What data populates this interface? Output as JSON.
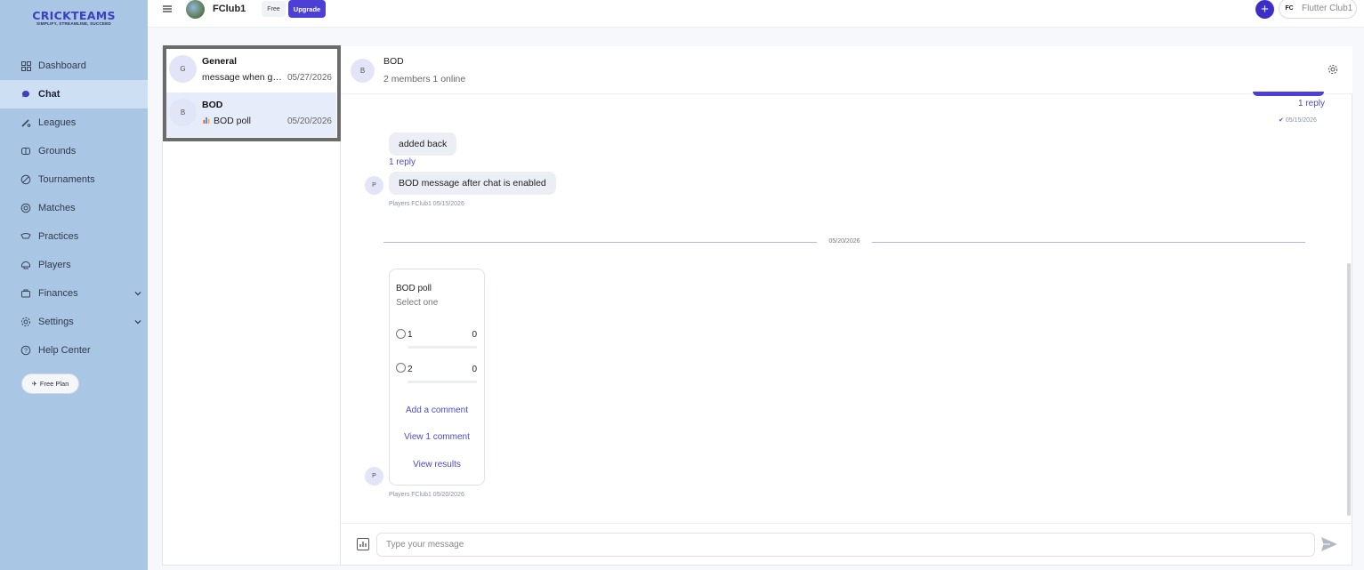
{
  "brand": {
    "title": "CRICKTEAMS",
    "tagline": "SIMPLIFY, STREAMLINE, SUCCEED"
  },
  "sidebar": {
    "items": [
      {
        "label": "Dashboard",
        "icon": "grid-icon"
      },
      {
        "label": "Chat",
        "icon": "chat-icon",
        "active": true
      },
      {
        "label": "Leagues",
        "icon": "bat-icon"
      },
      {
        "label": "Grounds",
        "icon": "ground-icon"
      },
      {
        "label": "Tournaments",
        "icon": "ball-icon"
      },
      {
        "label": "Matches",
        "icon": "match-icon"
      },
      {
        "label": "Practices",
        "icon": "practice-icon"
      },
      {
        "label": "Players",
        "icon": "helmet-icon"
      },
      {
        "label": "Finances",
        "icon": "wallet-icon",
        "expandable": true
      },
      {
        "label": "Settings",
        "icon": "gear-icon",
        "expandable": true
      },
      {
        "label": "Help Center",
        "icon": "help-icon"
      }
    ],
    "free_plan_label": "Free Plan"
  },
  "topbar": {
    "club_name": "FClub1",
    "free_badge": "Free",
    "upgrade_label": "Upgrade",
    "user_initials": "FC",
    "user_name": "Flutter Club1"
  },
  "channels": [
    {
      "initial": "G",
      "name": "General",
      "preview": "message when gl...",
      "date": "05/27/2026"
    },
    {
      "initial": "B",
      "name": "BOD",
      "preview": "BOD poll",
      "date": "05/20/2026",
      "selected": true
    }
  ],
  "chat": {
    "header": {
      "initial": "B",
      "title": "BOD",
      "subtitle": "2 members 1 online"
    },
    "top_reply": "1 reply",
    "top_meta": "05/15/2026",
    "messages": [
      {
        "text": "added back",
        "reply": "1 reply"
      },
      {
        "text": "BOD message after chat is enabled",
        "avatar": "P",
        "meta": "Players FClub1  05/15/2026"
      }
    ],
    "divider_date": "05/20/2026",
    "poll": {
      "title": "BOD poll",
      "subtitle": "Select one",
      "options": [
        {
          "label": "1",
          "count": "0",
          "fraction": 0
        },
        {
          "label": "2",
          "count": "0",
          "fraction": 0
        }
      ],
      "add_comment": "Add a comment",
      "view_comment": "View 1 comment",
      "view_results": "View results",
      "avatar": "P",
      "meta": "Players FClub1  05/20/2026"
    },
    "composer": {
      "placeholder": "Type your message"
    }
  },
  "colors": {
    "accent": "#4b3fd6",
    "sidebar": "#a9c6e4",
    "link": "#4b4bc7"
  }
}
